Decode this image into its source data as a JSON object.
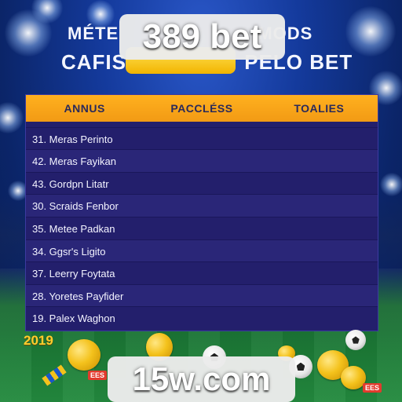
{
  "brand_top": "389 bet",
  "brand_bottom": "15w.com",
  "headline": {
    "line1_left": "MÉTE",
    "line1_right": "MODS",
    "line2_left": "CAFIS",
    "line2_right": "PELO BET"
  },
  "table": {
    "headers": [
      "ANNUS",
      "PACCLÉSS",
      "TOALIES"
    ],
    "rows": [
      "31. Meras Perinto",
      "42. Meras Fayikan",
      "43. Gordpn Litatr",
      "30. Scraids Fenbor",
      "35. Metee Padkan",
      "34. Ggsr's Ligito",
      "37. Leerry Foytata",
      "28. Yoretes Payfider",
      "19. Palex Waghon"
    ]
  },
  "decor": {
    "year": "2019",
    "tag_text": "EES"
  },
  "colors": {
    "header_orange": "#f7a21a",
    "table_bg": "#231f6c",
    "gold": "#ffcd2d"
  }
}
